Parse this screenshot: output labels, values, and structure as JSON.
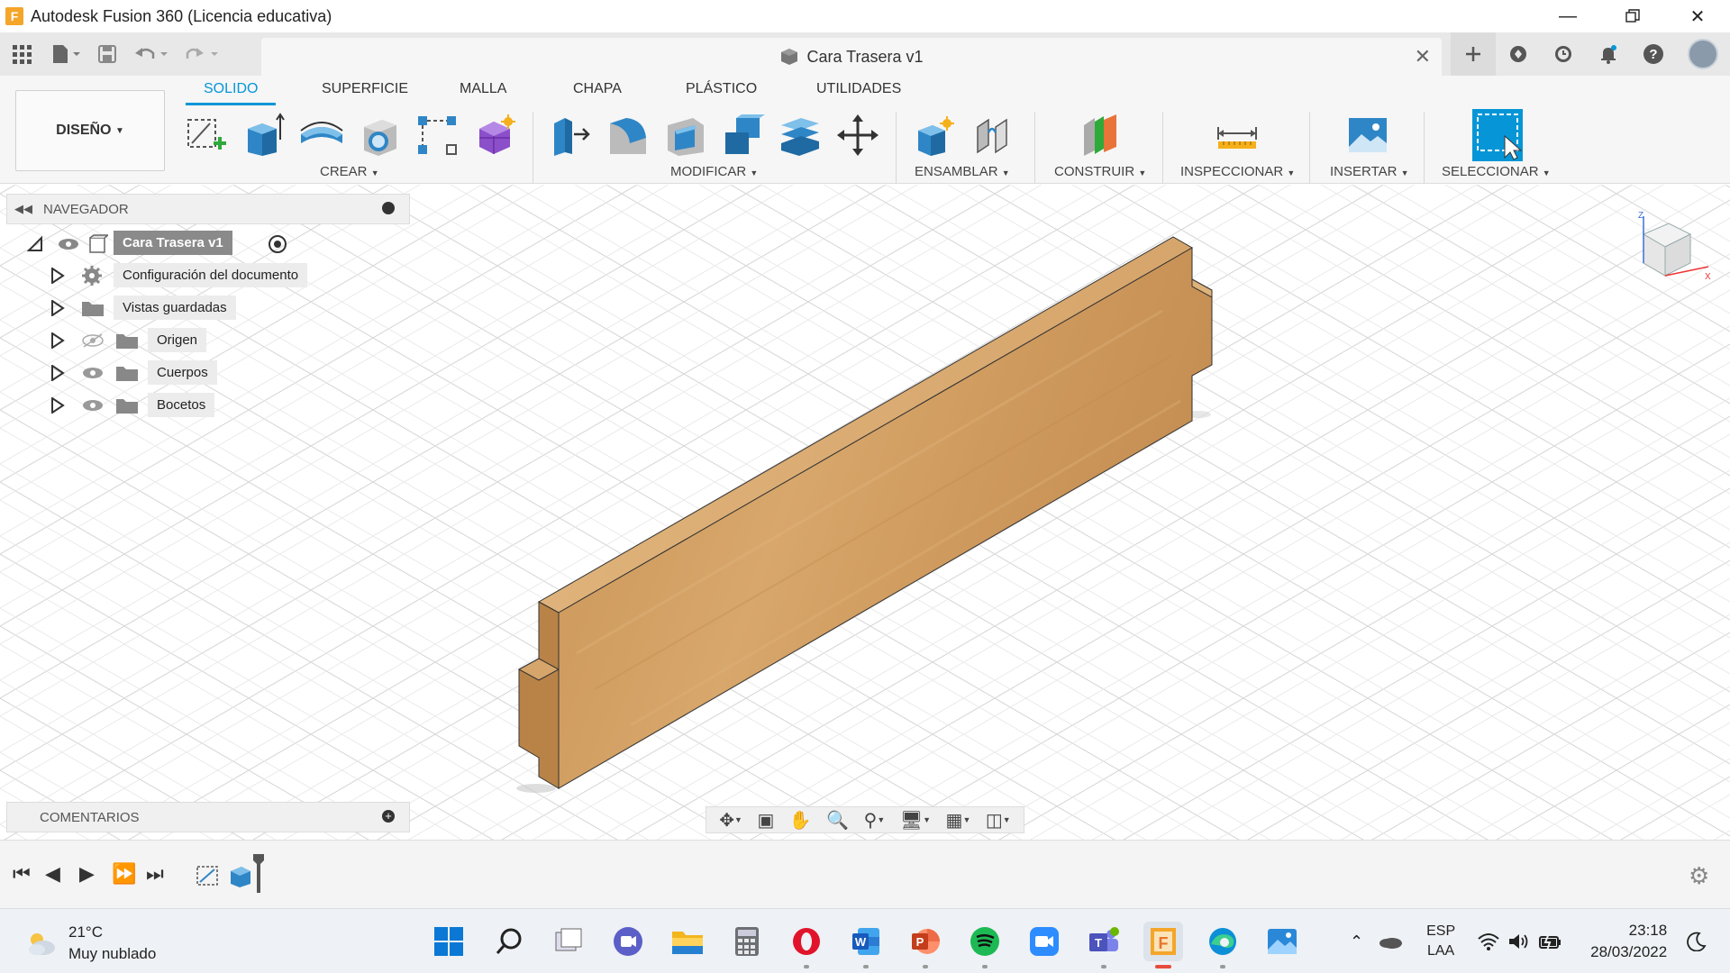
{
  "window": {
    "app_title": "Autodesk Fusion 360 (Licencia educativa)",
    "logo_letter": "F"
  },
  "appbar": {
    "doc_title": "Cara Trasera v1"
  },
  "ribbon": {
    "workspace": "DISEÑO",
    "tabs": [
      "SOLIDO",
      "SUPERFICIE",
      "MALLA",
      "CHAPA",
      "PLÁSTICO",
      "UTILIDADES"
    ],
    "active_tab": "SOLIDO",
    "groups": {
      "crear": "CREAR",
      "modificar": "MODIFICAR",
      "ensamblar": "ENSAMBLAR",
      "construir": "CONSTRUIR",
      "inspeccionar": "INSPECCIONAR",
      "insertar": "INSERTAR",
      "seleccionar": "SELECCIONAR"
    }
  },
  "navigator": {
    "header": "NAVEGADOR",
    "root": "Cara Trasera v1",
    "items": [
      {
        "label": "Configuración del documento"
      },
      {
        "label": "Vistas guardadas"
      },
      {
        "label": "Origen"
      },
      {
        "label": "Cuerpos"
      },
      {
        "label": "Bocetos"
      }
    ]
  },
  "comments": {
    "header": "COMENTARIOS"
  },
  "viewcube": {
    "axis_x": "X",
    "axis_z": "Z"
  },
  "taskbar": {
    "weather_temp": "21°C",
    "weather_desc": "Muy nublado",
    "lang_top": "ESP",
    "lang_bottom": "LAA",
    "time": "23:18",
    "date": "28/03/2022"
  },
  "colors": {
    "accent": "#0696d7",
    "wood": "#cf9a5e"
  }
}
